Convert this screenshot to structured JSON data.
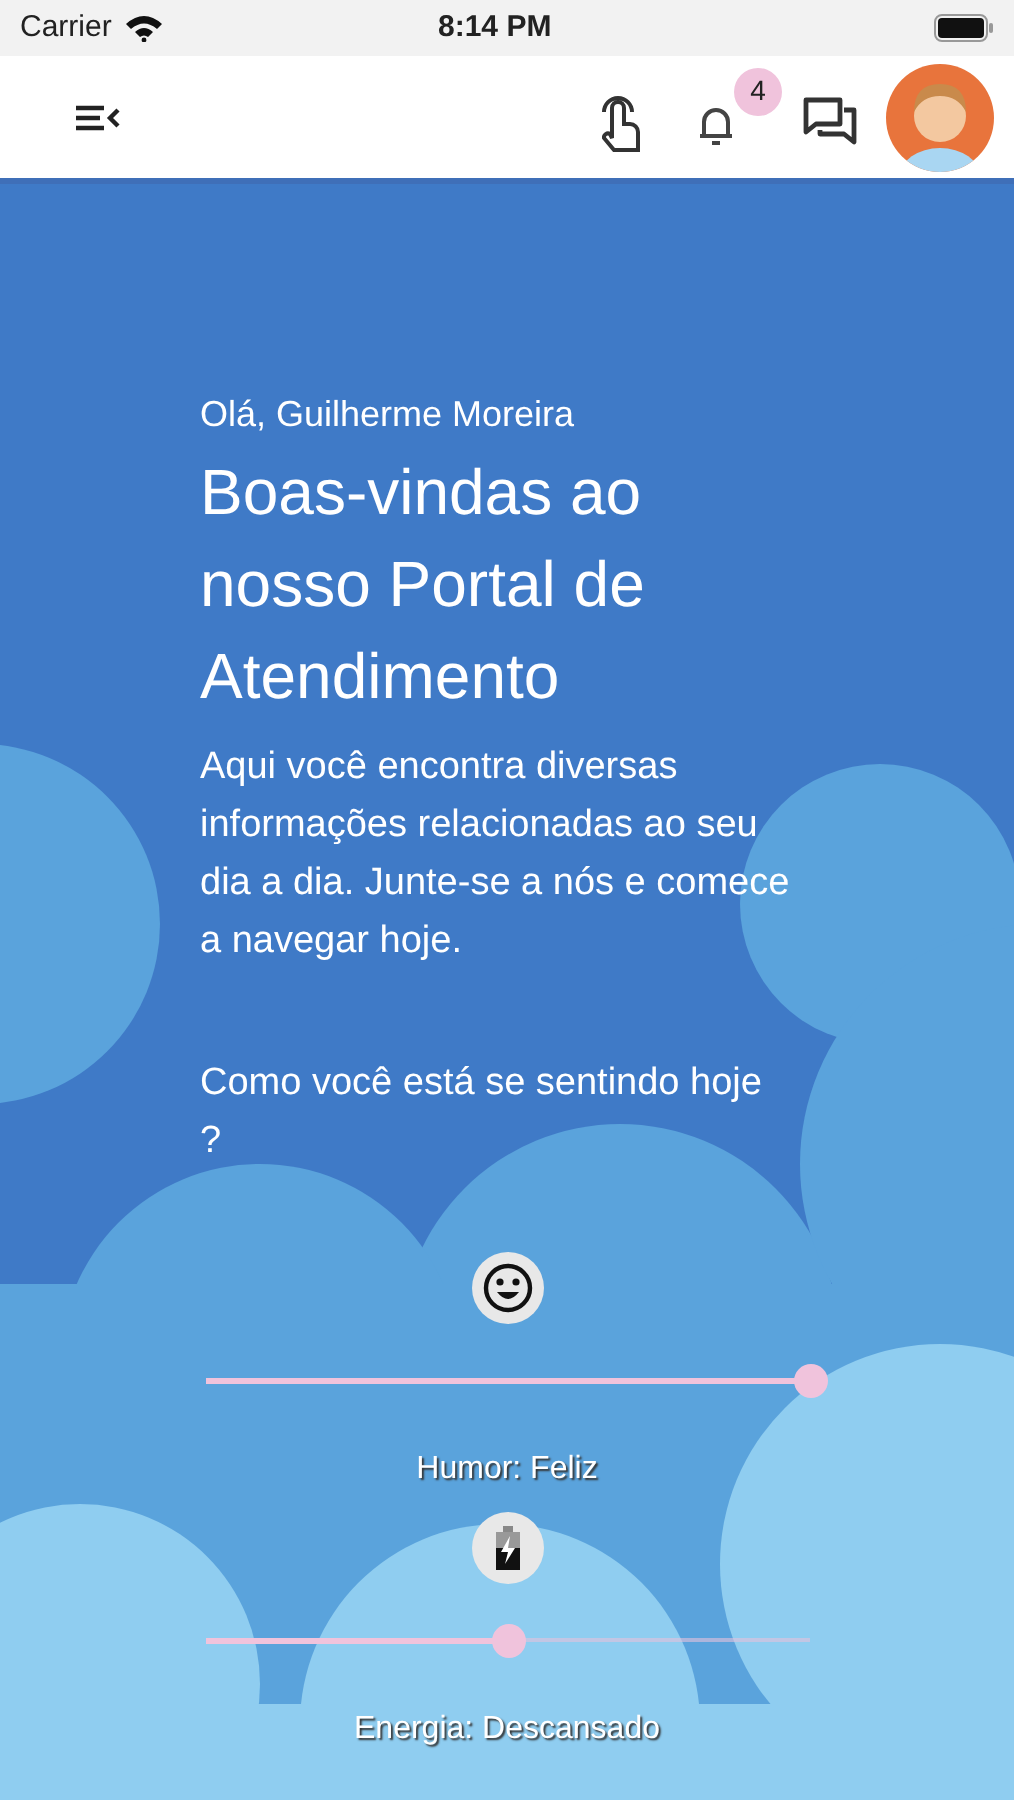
{
  "status_bar": {
    "carrier": "Carrier",
    "time": "8:14 PM"
  },
  "header": {
    "notifications_count": "4"
  },
  "greeting": "Olá, Guilherme Moreira",
  "title": "Boas-vindas ao nosso Portal de Atendimento",
  "description": "Aqui você encontra diversas informações relacionadas ao seu dia a dia. Junte-se a nós e comece a navegar hoje.",
  "question": "Como você está se sentindo hoje ?",
  "sliders": [
    {
      "kind": "mood",
      "level": 1.0,
      "reading": "Humor: Feliz"
    },
    {
      "kind": "energy",
      "level": 0.5,
      "reading": "Energia: Descansado"
    }
  ]
}
